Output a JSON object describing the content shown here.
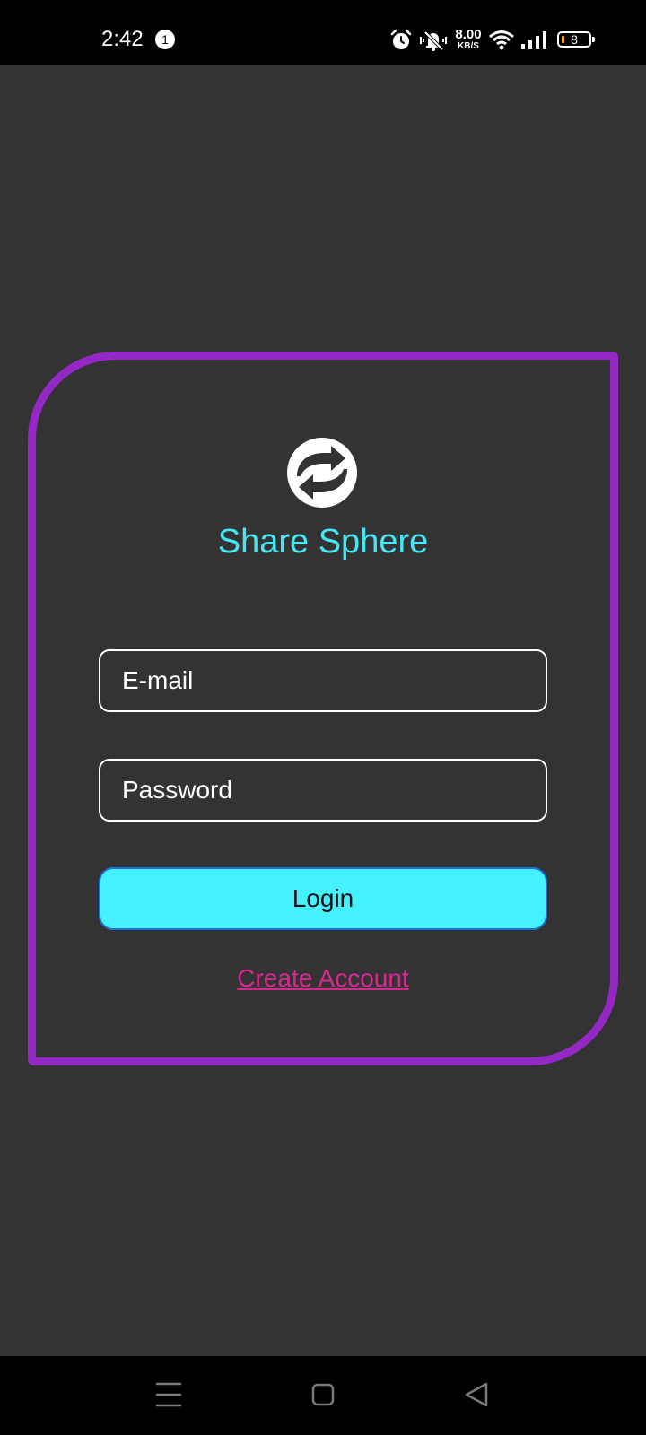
{
  "status_bar": {
    "time": "2:42",
    "notification_count": "1",
    "net_speed_value": "8.00",
    "net_speed_unit": "KB/S",
    "battery_level": "8"
  },
  "app": {
    "title": "Share Sphere",
    "logo_icon": "sync-arrows-icon"
  },
  "form": {
    "email_placeholder": "E-mail",
    "password_placeholder": "Password",
    "login_label": "Login",
    "create_account_label": "Create Account"
  },
  "colors": {
    "background": "#333333",
    "card_border": "#9328c4",
    "title": "#46e6f4",
    "login_button": "#45f0ff",
    "link": "#d6288f"
  },
  "nav_bar": {
    "icons": [
      "menu-icon",
      "home-square-icon",
      "back-triangle-icon"
    ]
  }
}
